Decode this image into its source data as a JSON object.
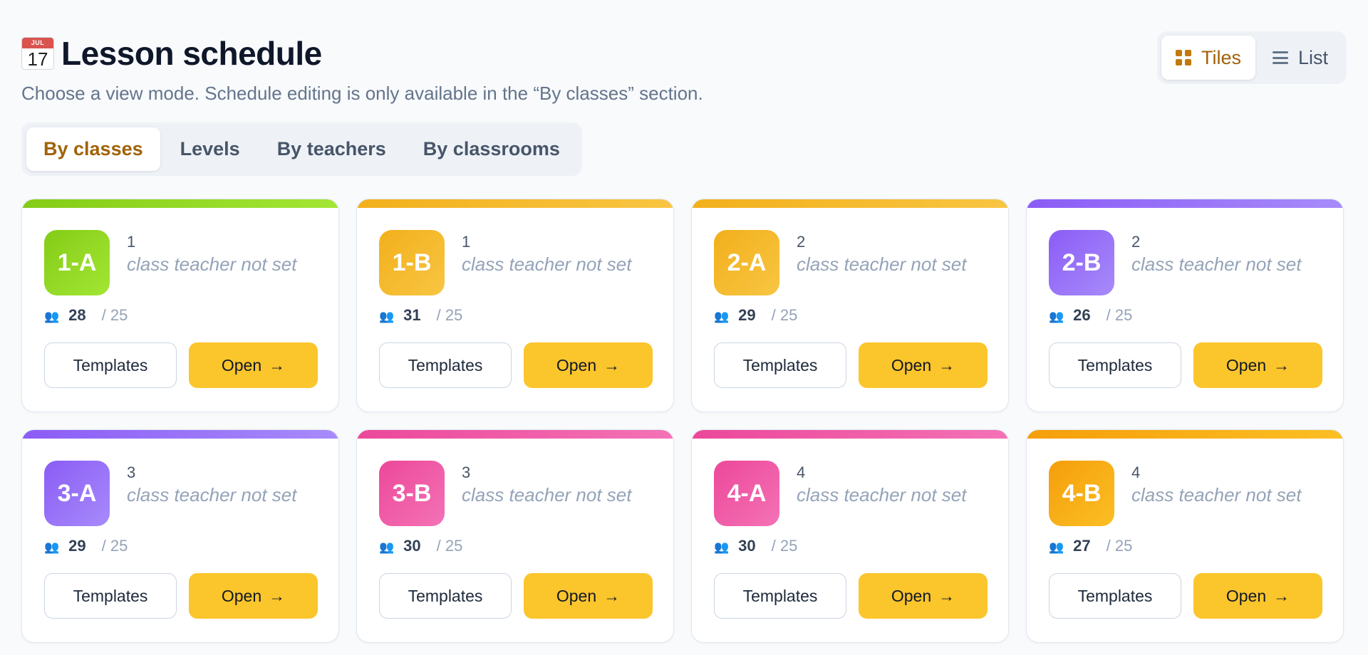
{
  "header": {
    "calendar_icon": {
      "name": "calendar-icon",
      "month": "JUL",
      "day": "17"
    },
    "title": "Lesson schedule",
    "subtitle": "Choose a view mode. Schedule editing is only available in the “By classes” section."
  },
  "view_toggle": {
    "tiles_label": "Tiles",
    "list_label": "List",
    "active": "Tiles"
  },
  "tabs": [
    {
      "label": "By classes",
      "active": true
    },
    {
      "label": "Levels",
      "active": false
    },
    {
      "label": "By teachers",
      "active": false
    },
    {
      "label": "By classrooms",
      "active": false
    }
  ],
  "cards": [
    {
      "code": "1-A",
      "level": "1",
      "teacher": "class teacher not set",
      "count": "28",
      "capacity": "/ 25",
      "templates_label": "Templates",
      "open_label": "Open",
      "open_arrow": "→",
      "color_start": "#84cc16",
      "color_end": "#a3e635"
    },
    {
      "code": "1-B",
      "level": "1",
      "teacher": "class teacher not set",
      "count": "31",
      "capacity": "/ 25",
      "templates_label": "Templates",
      "open_label": "Open",
      "open_arrow": "→",
      "color_start": "#f2b01c",
      "color_end": "#f8c542"
    },
    {
      "code": "2-A",
      "level": "2",
      "teacher": "class teacher not set",
      "count": "29",
      "capacity": "/ 25",
      "templates_label": "Templates",
      "open_label": "Open",
      "open_arrow": "→",
      "color_start": "#f2b01c",
      "color_end": "#f8c542"
    },
    {
      "code": "2-B",
      "level": "2",
      "teacher": "class teacher not set",
      "count": "26",
      "capacity": "/ 25",
      "templates_label": "Templates",
      "open_label": "Open",
      "open_arrow": "→",
      "color_start": "#8b5cf6",
      "color_end": "#a78bfa"
    },
    {
      "code": "3-A",
      "level": "3",
      "teacher": "class teacher not set",
      "count": "29",
      "capacity": "/ 25",
      "templates_label": "Templates",
      "open_label": "Open",
      "open_arrow": "→",
      "color_start": "#8b5cf6",
      "color_end": "#a78bfa"
    },
    {
      "code": "3-B",
      "level": "3",
      "teacher": "class teacher not set",
      "count": "30",
      "capacity": "/ 25",
      "templates_label": "Templates",
      "open_label": "Open",
      "open_arrow": "→",
      "color_start": "#ec4899",
      "color_end": "#f472b6"
    },
    {
      "code": "4-A",
      "level": "4",
      "teacher": "class teacher not set",
      "count": "30",
      "capacity": "/ 25",
      "templates_label": "Templates",
      "open_label": "Open",
      "open_arrow": "→",
      "color_start": "#ec4899",
      "color_end": "#f472b6"
    },
    {
      "code": "4-B",
      "level": "4",
      "teacher": "class teacher not set",
      "count": "27",
      "capacity": "/ 25",
      "templates_label": "Templates",
      "open_label": "Open",
      "open_arrow": "→",
      "color_start": "#f59e0b",
      "color_end": "#fbbf24"
    }
  ]
}
